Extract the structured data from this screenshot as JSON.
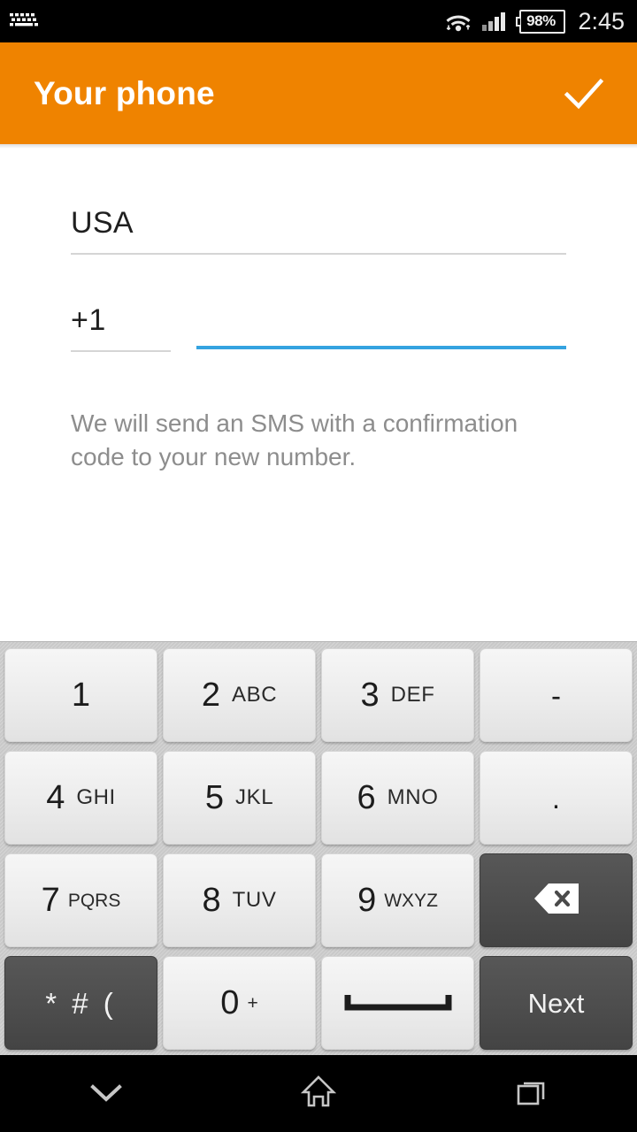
{
  "status_bar": {
    "notification_icon": "keyboard-icon",
    "wifi_icon": "wifi-icon",
    "signal_icon": "signal-bars-icon",
    "battery_text": "98%",
    "clock": "2:45"
  },
  "app_bar": {
    "title": "Your phone",
    "confirm_icon": "checkmark-icon",
    "background_color": "#ef8300"
  },
  "form": {
    "country": {
      "label": "country",
      "value": "USA",
      "placeholder": "Country"
    },
    "country_code": {
      "label": "country-code",
      "value": "+1",
      "placeholder": "+"
    },
    "phone_number": {
      "label": "phone-number",
      "value": "",
      "placeholder": "",
      "focused": true,
      "focus_color": "#35a3e0"
    },
    "helper_text": "We will send an SMS with a confirmation code to your new number."
  },
  "keyboard": {
    "rows": [
      [
        {
          "main": "1",
          "sub": "",
          "style": "light",
          "name": "key-1"
        },
        {
          "main": "2",
          "sub": "ABC",
          "style": "light",
          "name": "key-2"
        },
        {
          "main": "3",
          "sub": "DEF",
          "style": "light",
          "name": "key-3"
        },
        {
          "main": "-",
          "sub": "",
          "style": "light",
          "name": "key-dash"
        }
      ],
      [
        {
          "main": "4",
          "sub": "GHI",
          "style": "light",
          "name": "key-4"
        },
        {
          "main": "5",
          "sub": "JKL",
          "style": "light",
          "name": "key-5"
        },
        {
          "main": "6",
          "sub": "MNO",
          "style": "light",
          "name": "key-6"
        },
        {
          "main": ".",
          "sub": "",
          "style": "light",
          "name": "key-period"
        }
      ],
      [
        {
          "main": "7",
          "sub": "PQRS",
          "style": "light",
          "name": "key-7"
        },
        {
          "main": "8",
          "sub": "TUV",
          "style": "light",
          "name": "key-8"
        },
        {
          "main": "9",
          "sub": "WXYZ",
          "style": "light",
          "name": "key-9"
        },
        {
          "main": "",
          "sub": "",
          "style": "dark",
          "name": "key-backspace",
          "icon": "backspace-icon"
        }
      ],
      [
        {
          "main": "* # (",
          "sub": "",
          "style": "dark",
          "name": "key-symbols"
        },
        {
          "main": "0",
          "sub": "+",
          "style": "light",
          "name": "key-0"
        },
        {
          "main": "",
          "sub": "",
          "style": "light",
          "name": "key-space",
          "icon": "spacebar-icon"
        },
        {
          "main": "Next",
          "sub": "",
          "style": "dark",
          "name": "key-next"
        }
      ]
    ]
  },
  "nav_bar": {
    "back_icon": "chevron-down-icon",
    "home_icon": "home-icon",
    "recents_icon": "recent-apps-icon"
  }
}
